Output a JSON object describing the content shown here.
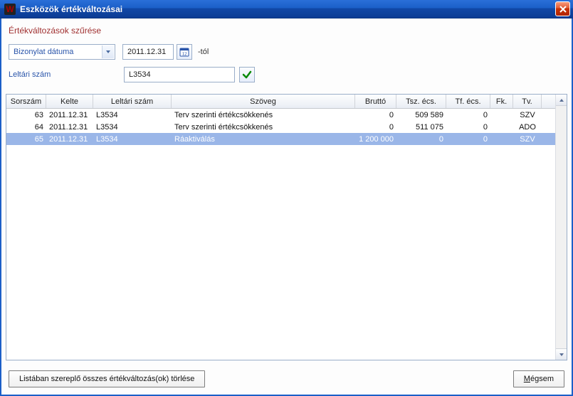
{
  "window": {
    "title": "Eszközök értékváltozásai",
    "app_icon_letter": "W"
  },
  "filters": {
    "section_title": "Értékváltozások szűrése",
    "date_type_selected": "Bizonylat dátuma",
    "date_value": "2011.12.31",
    "date_suffix": "-tól",
    "inventory_label": "Leltári szám",
    "inventory_value": "L3534"
  },
  "table": {
    "columns": {
      "sorszam": "Sorszám",
      "kelte": "Kelte",
      "leltari": "Leltári szám",
      "szoveg": "Szöveg",
      "brutto": "Bruttó",
      "tszecs": "Tsz. écs.",
      "tfecs": "Tf. écs.",
      "fk": "Fk.",
      "tv": "Tv."
    },
    "rows": [
      {
        "sorszam": "63",
        "kelte": "2011.12.31",
        "leltari": "L3534",
        "szoveg": "Terv szerinti értékcsökkenés",
        "brutto": "0",
        "tszecs": "509 589",
        "tfecs": "0",
        "fk": "",
        "tv": "SZV",
        "selected": false
      },
      {
        "sorszam": "64",
        "kelte": "2011.12.31",
        "leltari": "L3534",
        "szoveg": "Terv szerinti értékcsökkenés",
        "brutto": "0",
        "tszecs": "511 075",
        "tfecs": "0",
        "fk": "",
        "tv": "ADO",
        "selected": false
      },
      {
        "sorszam": "65",
        "kelte": "2011.12.31",
        "leltari": "L3534",
        "szoveg": "Ráaktiválás",
        "brutto": "1 200 000",
        "tszecs": "0",
        "tfecs": "0",
        "fk": "",
        "tv": "SZV",
        "selected": true
      }
    ]
  },
  "footer": {
    "delete_all": "Listában szereplő összes értékváltozás(ok) törlése",
    "cancel_prefix": "M",
    "cancel_rest": "égsem"
  }
}
